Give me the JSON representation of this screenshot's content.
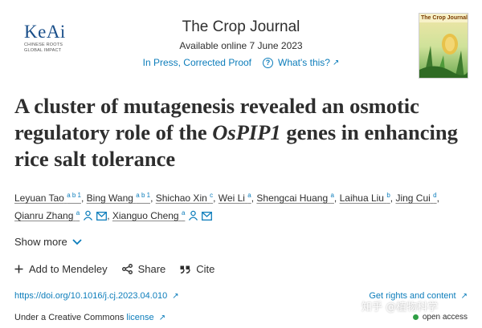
{
  "publisher": {
    "logo_text": "KeAi",
    "tagline_1": "CHINESE ROOTS",
    "tagline_2": "GLOBAL IMPACT"
  },
  "journal": {
    "title": "The Crop Journal",
    "available": "Available online 7 June 2023",
    "status_link": "In Press, Corrected Proof",
    "whats_this": "What's this?",
    "cover_title": "The Crop Journal"
  },
  "article": {
    "title_part1": "A cluster of mutagenesis revealed an osmotic regulatory role of the ",
    "title_italic": "OsPIP1",
    "title_part2": " genes in enhancing rice salt tolerance"
  },
  "authors": [
    {
      "name": "Leyuan Tao",
      "sup": "a b 1"
    },
    {
      "name": "Bing Wang",
      "sup": "a b 1"
    },
    {
      "name": "Shichao Xin",
      "sup": "c"
    },
    {
      "name": "Wei Li",
      "sup": "a"
    },
    {
      "name": "Shengcai Huang",
      "sup": "a"
    },
    {
      "name": "Laihua Liu",
      "sup": "b"
    },
    {
      "name": "Jing Cui",
      "sup": "d"
    },
    {
      "name": "Qianru Zhang",
      "sup": "a"
    },
    {
      "name": "Xianguo Cheng",
      "sup": "a"
    }
  ],
  "show_more": "Show more",
  "actions": {
    "mendeley": "Add to Mendeley",
    "share": "Share",
    "cite": "Cite"
  },
  "doi": "https://doi.org/10.1016/j.cj.2023.04.010",
  "rights": "Get rights and content",
  "license_prefix": "Under a Creative Commons ",
  "license_link": "license",
  "open_access": "open access",
  "watermark": "知乎 @植物科学",
  "colors": {
    "link": "#0c7dbb",
    "text": "#2e2e2e",
    "brand": "#1a4f8a",
    "open_access": "#2f9e44"
  },
  "icons": {
    "whats_this": "question-circle-icon",
    "external": "external-arrow-icon",
    "person": "person-icon",
    "email": "envelope-icon",
    "chevron": "chevron-down-icon",
    "add": "plus-icon",
    "share": "share-icon",
    "cite": "quote-icon"
  }
}
